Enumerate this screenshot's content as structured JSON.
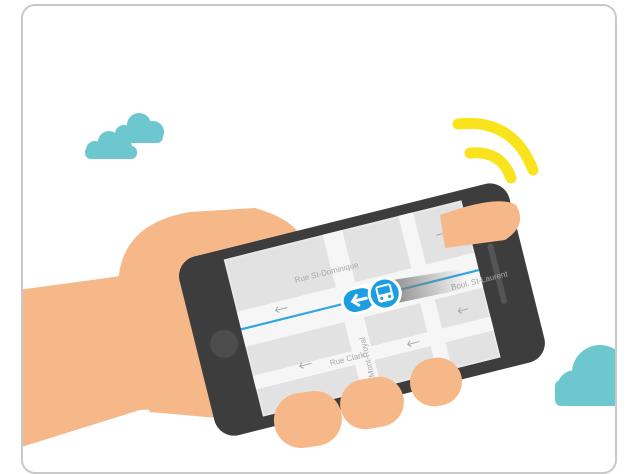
{
  "illustration": {
    "streets": {
      "top": "Rue St-Dominique",
      "middle": "Rue Clark",
      "vertical": "Mont-Royal",
      "right": "Boul. St-Laurent"
    },
    "icons": [
      "cloud-icon",
      "wifi-signal-icon",
      "bus-icon",
      "left-arrow-icon",
      "direction-arrow-icon"
    ],
    "colors": {
      "background": "#ffffff",
      "border": "#c9c9c9",
      "cloud": "#6cc7cf",
      "signal": "#f9e31c",
      "skin": "#f7b889",
      "phone_body": "#3d3d3d",
      "map_background": "#e8e8e8",
      "route_line": "#2fa7e1",
      "bus_marker": "#1d9ee2"
    }
  }
}
